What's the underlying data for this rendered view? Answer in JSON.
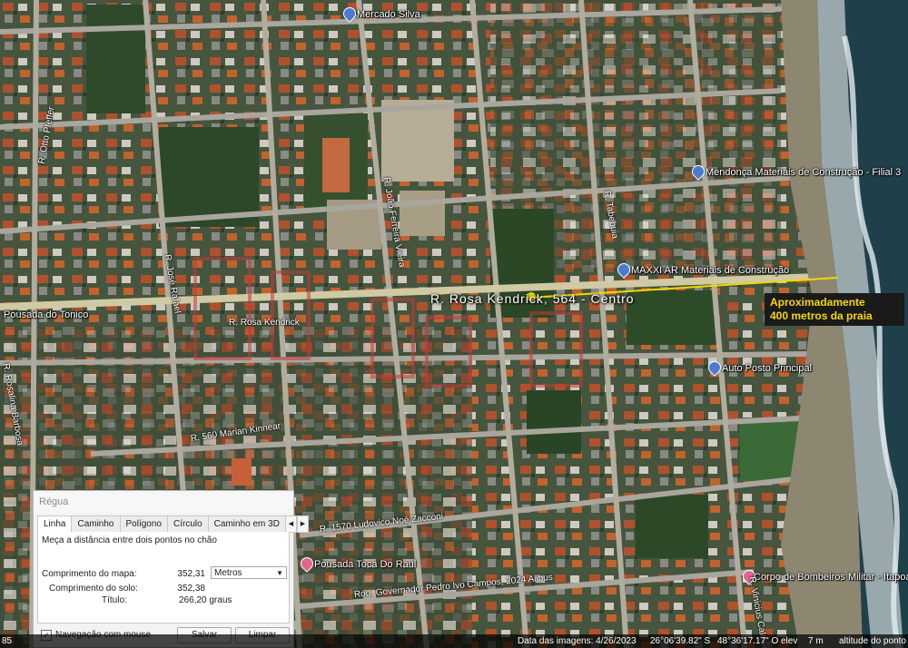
{
  "map": {
    "main_street": "R. Rosa Kendrick, 564 - Centro",
    "annotation": {
      "line1": "Aproximadamente",
      "line2": "400 metros da praia",
      "color": "#f5d800"
    },
    "places": [
      {
        "name": "Mercado Silva",
        "pin": "blue"
      },
      {
        "name": "Mendonça Materiais de Construção - Filial 3",
        "pin": "blue"
      },
      {
        "name": "MAXXI AR Materiais de Construção",
        "pin": "blue"
      },
      {
        "name": "Auto Posto Principal",
        "pin": "blue"
      },
      {
        "name": "Pousada do Tonico",
        "pin": "none"
      },
      {
        "name": "Pousada Toca Do Raul",
        "pin": "pink"
      },
      {
        "name": "Corpo de Bombeiros Militar - Itapoá",
        "pin": "pink"
      }
    ],
    "streets": [
      "R. Otto Pfeffer",
      "R. João Ferreira Vieira",
      "R. Tabebuia",
      "R. José Rafael",
      "R. Rosa Kendrick",
      "R. 560 Marian Kinnear",
      "R. 1570 Ludovico Noé Zacconi",
      "Rod. Governador Pedro Ivo Campos, 2024 Alibus",
      "R. Vinicius Caldeira",
      "R. Rosalina Barbosa"
    ]
  },
  "regua": {
    "title": "Régua",
    "tabs": [
      "Linha",
      "Caminho",
      "Polígono",
      "Círculo",
      "Caminho em 3D"
    ],
    "active_tab": "Linha",
    "description": "Meça a distância entre dois pontos no chão",
    "map_length_label": "Comprimento do mapa:",
    "map_length_value": "352,31",
    "unit": "Metros",
    "ground_length_label": "Comprimento do solo:",
    "ground_length_value": "352,38",
    "heading_label": "Título:",
    "heading_value": "266,20 graus",
    "mouse_nav_label": "Navegação com mouse",
    "mouse_nav_checked": true,
    "save_label": "Salvar",
    "clear_label": "Limpar"
  },
  "statusbar": {
    "left_text": "85",
    "imagery_date": "Data das imagens: 4/26/2023",
    "lat": "26°06'39.82\" S",
    "lon": "48°36'17.17\" O",
    "elev_label": "elev",
    "elev_value": "7 m",
    "altitude_label": "altitude do ponto"
  }
}
